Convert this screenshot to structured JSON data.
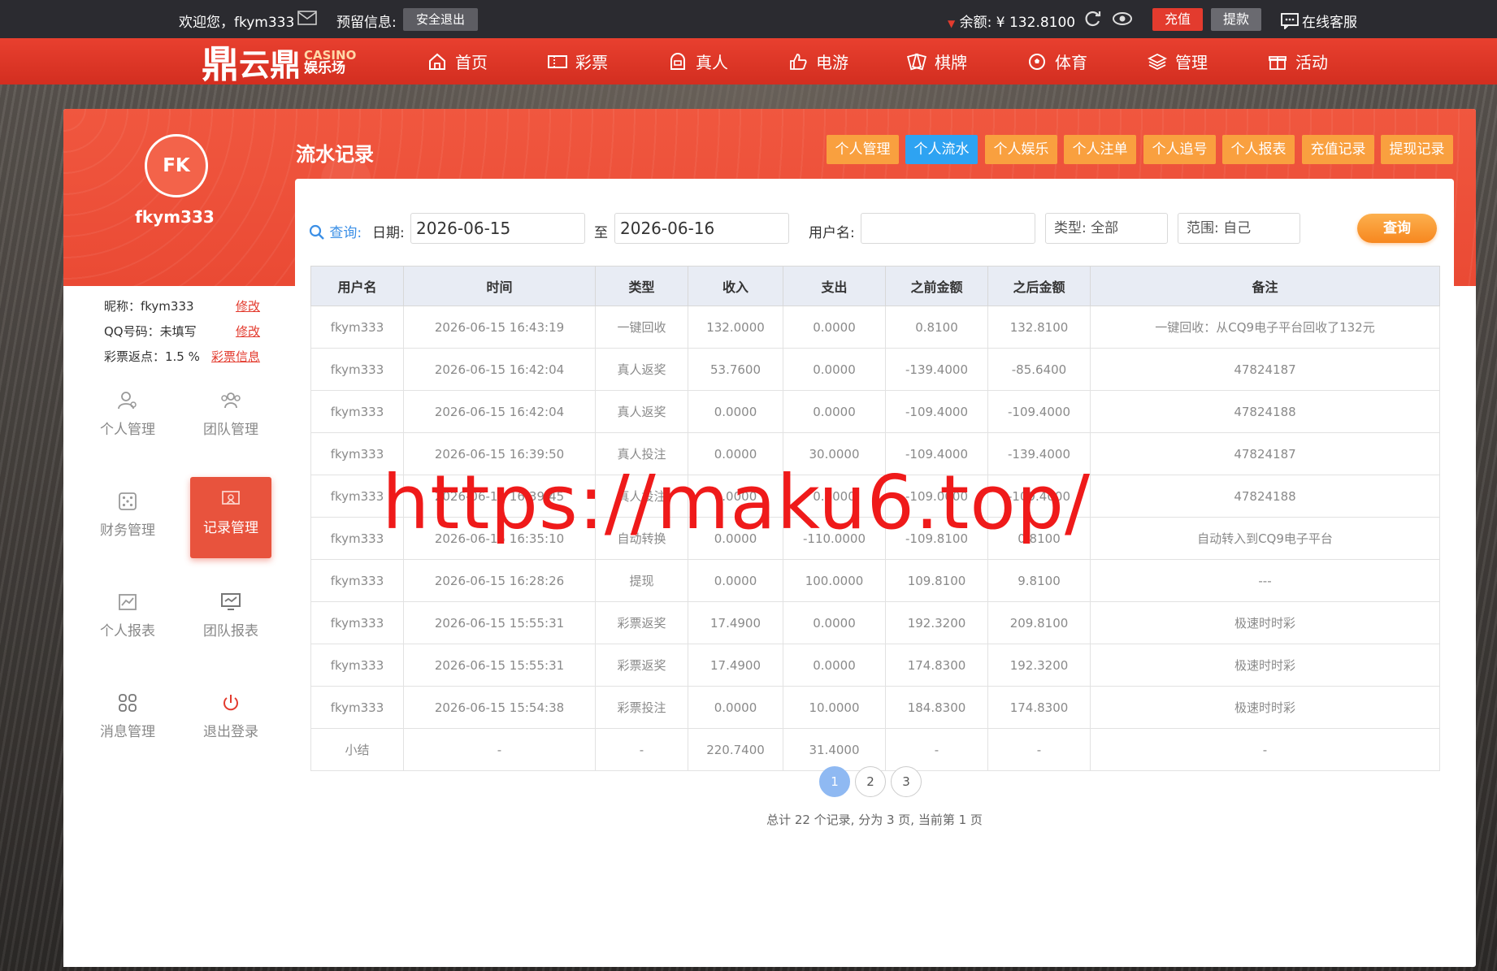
{
  "topbar": {
    "welcome": "欢迎您，fkym333",
    "reserved_label": "预留信息:",
    "logout_btn": "安全退出",
    "balance": "余额: ¥ 132.8100",
    "recharge_btn": "充值",
    "withdraw_btn": "提款",
    "support": "在线客服"
  },
  "logo": {
    "mark": "鼎",
    "name": "云鼎",
    "en": "CASINO",
    "cn": "娱乐场"
  },
  "nav": [
    {
      "label": "首页",
      "icon": "home-icon"
    },
    {
      "label": "彩票",
      "icon": "ticket-icon"
    },
    {
      "label": "真人",
      "icon": "live-icon"
    },
    {
      "label": "电游",
      "icon": "thumb-icon"
    },
    {
      "label": "棋牌",
      "icon": "cards-icon"
    },
    {
      "label": "体育",
      "icon": "ball-icon"
    },
    {
      "label": "管理",
      "icon": "layers-icon"
    },
    {
      "label": "活动",
      "icon": "gift-icon"
    }
  ],
  "profile": {
    "avatar": "FK",
    "username": "fkym333",
    "nickname": "昵称：fkym333",
    "nickname_edit": "修改",
    "qq": "QQ号码：未填写",
    "qq_edit": "修改",
    "rebate": "彩票返点：1.5 %",
    "rebate_link": "彩票信息"
  },
  "sidebar": [
    {
      "label": "个人管理",
      "icon": "user-icon"
    },
    {
      "label": "团队管理",
      "icon": "team-icon"
    },
    {
      "label": "财务管理",
      "icon": "dice-icon"
    },
    {
      "label": "记录管理",
      "icon": "record-icon"
    },
    {
      "label": "个人报表",
      "icon": "chart-icon"
    },
    {
      "label": "团队报表",
      "icon": "monitor-icon"
    },
    {
      "label": "消息管理",
      "icon": "grid-icon"
    },
    {
      "label": "退出登录",
      "icon": "power-icon"
    }
  ],
  "page_title": "流水记录",
  "tabs": [
    "个人管理",
    "个人流水",
    "个人娱乐",
    "个人注单",
    "个人追号",
    "个人报表",
    "充值记录",
    "提现记录"
  ],
  "filter": {
    "query_label": "查询:",
    "date_label": "日期:",
    "date_from": "2026-06-15",
    "to_label": "至",
    "date_to": "2026-06-16",
    "user_label": "用户名:",
    "user_value": "",
    "type": "类型: 全部",
    "scope": "范围: 自己",
    "search_btn": "查询"
  },
  "table": {
    "headers": [
      "用户名",
      "时间",
      "类型",
      "收入",
      "支出",
      "之前金额",
      "之后金额",
      "备注"
    ],
    "rows": [
      [
        "fkym333",
        "2026-06-15 16:43:19",
        "一键回收",
        "132.0000",
        "0.0000",
        "0.8100",
        "132.8100",
        "一键回收：从CQ9电子平台回收了132元"
      ],
      [
        "fkym333",
        "2026-06-15 16:42:04",
        "真人返奖",
        "53.7600",
        "0.0000",
        "-139.4000",
        "-85.6400",
        "47824187"
      ],
      [
        "fkym333",
        "2026-06-15 16:42:04",
        "真人返奖",
        "0.0000",
        "0.0000",
        "-109.4000",
        "-109.4000",
        "47824188"
      ],
      [
        "fkym333",
        "2026-06-15 16:39:50",
        "真人投注",
        "0.0000",
        "30.0000",
        "-109.4000",
        "-139.4000",
        "47824187"
      ],
      [
        "fkym333",
        "2026-06-15 16:39:45",
        "真人投注",
        "0.0000",
        "0.4000",
        "-109.0000",
        "-109.4000",
        "47824188"
      ],
      [
        "fkym333",
        "2026-06-15 16:35:10",
        "自动转换",
        "0.0000",
        "-110.0000",
        "-109.8100",
        "0.8100",
        "自动转入到CQ9电子平台"
      ],
      [
        "fkym333",
        "2026-06-15 16:28:26",
        "提现",
        "0.0000",
        "100.0000",
        "109.8100",
        "9.8100",
        "---"
      ],
      [
        "fkym333",
        "2026-06-15 15:55:31",
        "彩票返奖",
        "17.4900",
        "0.0000",
        "192.3200",
        "209.8100",
        "极速时时彩"
      ],
      [
        "fkym333",
        "2026-06-15 15:55:31",
        "彩票返奖",
        "17.4900",
        "0.0000",
        "174.8300",
        "192.3200",
        "极速时时彩"
      ],
      [
        "fkym333",
        "2026-06-15 15:54:38",
        "彩票投注",
        "0.0000",
        "10.0000",
        "184.8300",
        "174.8300",
        "极速时时彩"
      ],
      [
        "小结",
        "-",
        "-",
        "220.7400",
        "31.4000",
        "-",
        "-",
        "-"
      ]
    ]
  },
  "pager": {
    "pages": [
      "1",
      "2",
      "3"
    ],
    "info": "总计 22 个记录, 分为 3 页, 当前第 1 页"
  },
  "watermark": "https://maku6.top/",
  "colors": {
    "nav_red": "#e33b2e",
    "tab_orange": "#f9a03f",
    "tab_active": "#2ea3f2",
    "watermark": "#ef1a1a"
  }
}
